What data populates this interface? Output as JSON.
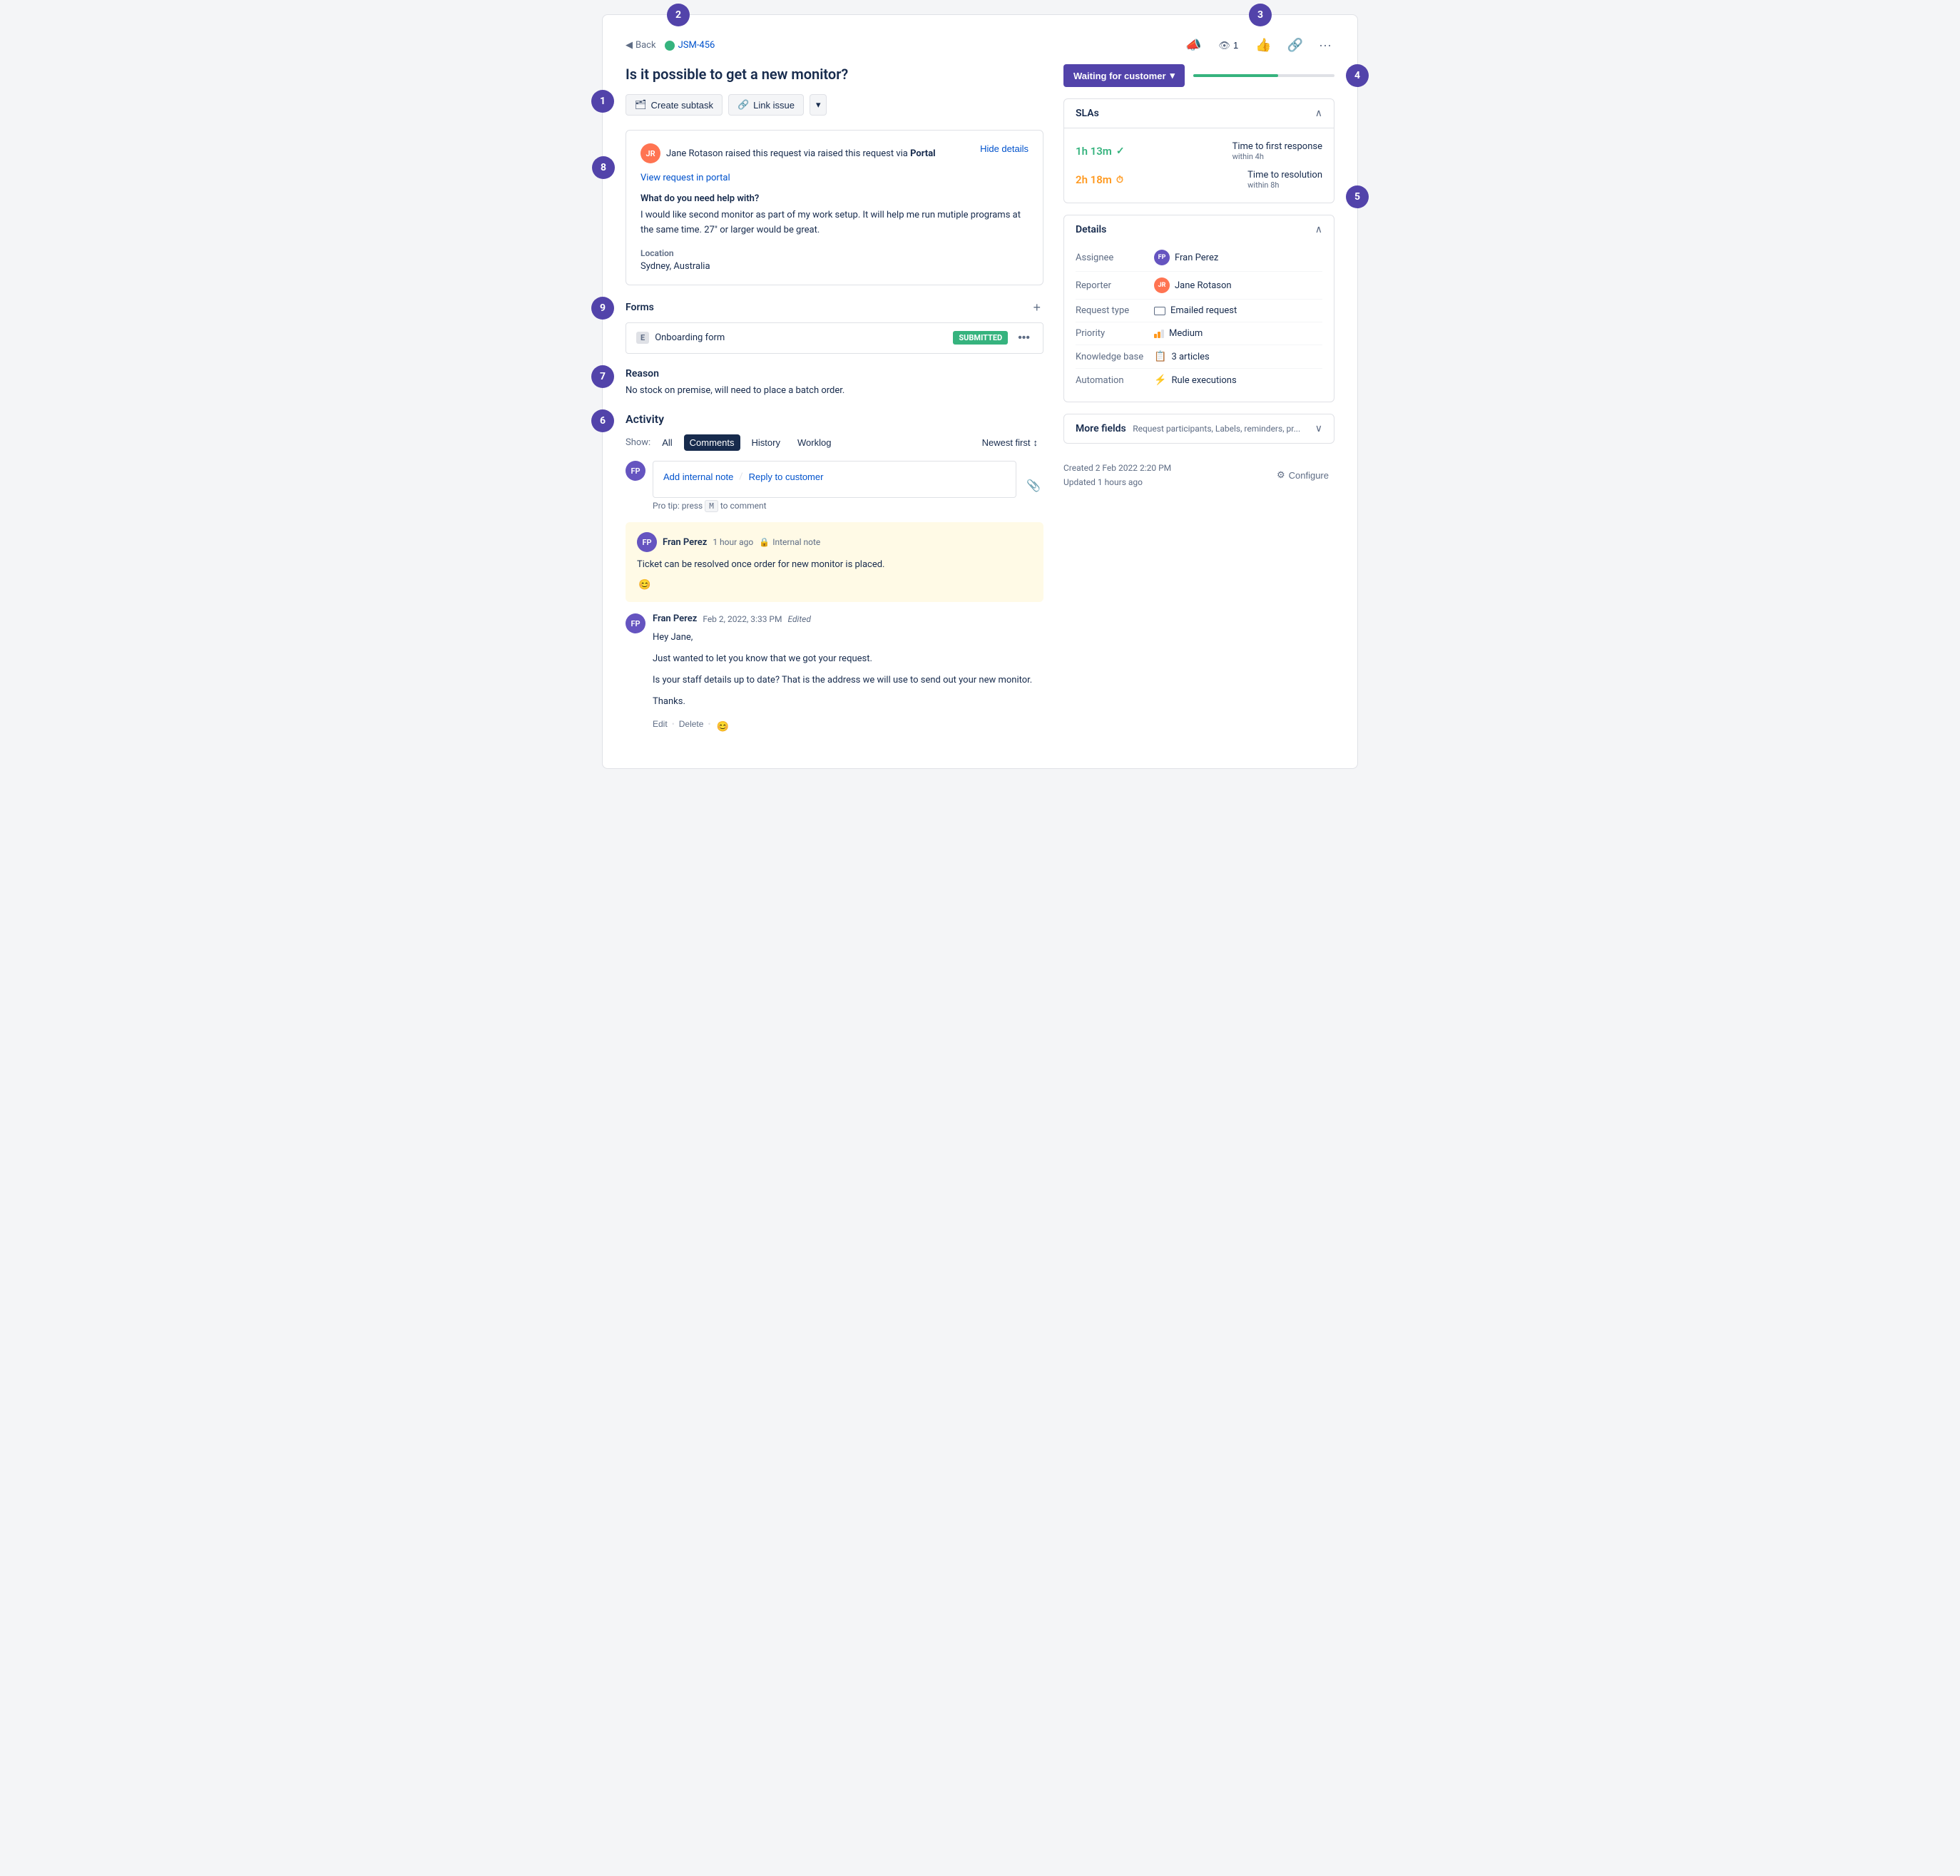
{
  "circles": {
    "c1": "1",
    "c2": "2",
    "c3": "3",
    "c4": "4",
    "c5": "5",
    "c6": "6",
    "c7": "7",
    "c8": "8",
    "c9": "9"
  },
  "breadcrumb": {
    "back_label": "Back",
    "issue_key": "JSM-456"
  },
  "top_actions": {
    "watch_count": "1",
    "thumbs_up": "👍",
    "share": "🔗",
    "more": "•••"
  },
  "issue": {
    "title": "Is it possible to get a new monitor?"
  },
  "toolbar": {
    "create_subtask": "Create subtask",
    "link_issue": "Link issue",
    "dropdown": "▾"
  },
  "request": {
    "reporter_name": "Jane Rotason",
    "raised_text": "raised this request via",
    "portal": "Portal",
    "hide_details": "Hide details",
    "view_request": "View request in portal",
    "help_label": "What do you need help with?",
    "help_text": "I would like second monitor as part of my work setup. It will help me run mutiple programs at the same time. 27\" or larger would be great.",
    "location_label": "Location",
    "location_value": "Sydney, Australia"
  },
  "forms": {
    "title": "Forms",
    "add_icon": "+",
    "form_key": "E",
    "form_name": "Onboarding form",
    "submitted": "SUBMITTED",
    "more": "•••"
  },
  "reason": {
    "title": "Reason",
    "text": "No stock on premise, will need to place a batch order."
  },
  "activity": {
    "title": "Activity",
    "show_label": "Show:",
    "filters": [
      "All",
      "Comments",
      "History",
      "Worklog"
    ],
    "active_filter": "Comments",
    "sort_label": "Newest first",
    "sort_icon": "↕",
    "add_internal_note": "Add internal note",
    "slash": "/",
    "reply_to_customer": "Reply to customer",
    "pro_tip": "Pro tip: press",
    "key_m": "M",
    "pro_tip_suffix": "to comment"
  },
  "internal_note": {
    "author": "Fran Perez",
    "time": "1 hour ago",
    "bullet": "•",
    "lock": "🔒",
    "type": "Internal note",
    "text": "Ticket can be resolved once order for new monitor is placed.",
    "emoji": "😊"
  },
  "comment": {
    "author": "Fran Perez",
    "time": "Feb 2, 2022, 3:33 PM",
    "edited": "Edited",
    "body_line1": "Hey Jane,",
    "body_line2": "Just wanted to let you know that we got your request.",
    "body_line3": "Is your staff details up to date? That is the address we will use to send out your new monitor.",
    "body_line4": "Thanks.",
    "edit": "Edit",
    "delete": "Delete",
    "emoji": "😊"
  },
  "sidebar": {
    "status": "Waiting for customer",
    "status_dropdown": "▾",
    "sla_title": "SLAs",
    "sla1_time": "1h 13m",
    "sla1_label": "Time to first response",
    "sla1_sub": "within 4h",
    "sla2_time": "2h 18m",
    "sla2_label": "Time to resolution",
    "sla2_sub": "within 8h",
    "details_title": "Details",
    "assignee_label": "Assignee",
    "assignee_name": "Fran Perez",
    "reporter_label": "Reporter",
    "reporter_name": "Jane Rotason",
    "request_type_label": "Request type",
    "request_type": "Emailed request",
    "priority_label": "Priority",
    "priority": "Medium",
    "kb_label": "Knowledge base",
    "kb_value": "3 articles",
    "automation_label": "Automation",
    "automation_value": "Rule executions",
    "more_fields_title": "More fields",
    "more_fields_sub": "Request participants, Labels, reminders, pr...",
    "created": "Created 2 Feb 2022 2:20 PM",
    "updated": "Updated 1 hours ago",
    "configure": "Configure"
  }
}
